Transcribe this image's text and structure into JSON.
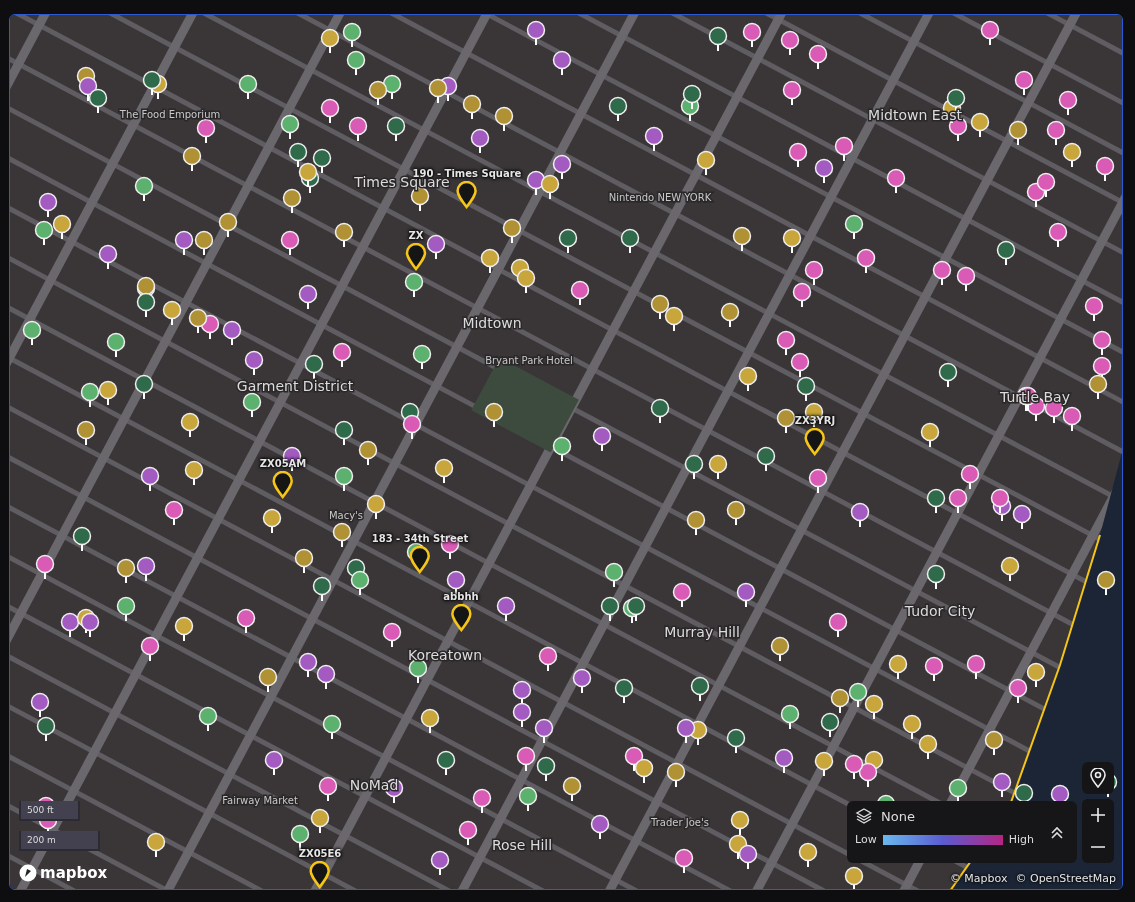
{
  "markers": [
    {
      "label": "190 - Times Square"
    },
    {
      "label": "ZX"
    },
    {
      "label": "ZX05AM"
    },
    {
      "label": "ZX3YRJ"
    },
    {
      "label": "183 - 34th Street"
    },
    {
      "label": "abbhh"
    },
    {
      "label": "ZX05E6"
    }
  ],
  "places": [
    "Times Square",
    "Midtown East",
    "Midtown",
    "Garment District",
    "Koreatown",
    "Murray Hill",
    "Tudor City",
    "NoMad",
    "Rose Hill",
    "Turtle Bay",
    "Fairway Market",
    "Macy's",
    "Bryant Park Hotel",
    "Nintendo NEW YORK",
    "The Food Emporium",
    "Trader Joe's"
  ],
  "layer_panel": {
    "layer": "None",
    "low_label": "Low",
    "high_label": "High",
    "expanded": false
  },
  "scale": [
    "500 ft",
    "200 m"
  ],
  "logo": "mapbox",
  "attribution": [
    "© Mapbox",
    "© OpenStreetMap"
  ]
}
